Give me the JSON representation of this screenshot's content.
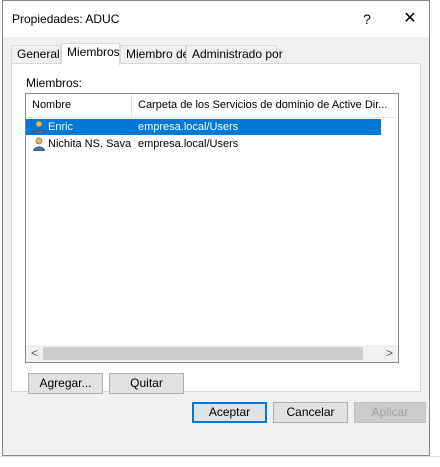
{
  "window": {
    "title": "Propiedades: ADUC",
    "help_label": "?",
    "close_label": "✕"
  },
  "tabs": [
    {
      "label": "General",
      "active": false
    },
    {
      "label": "Miembros",
      "active": true
    },
    {
      "label": "Miembro de",
      "active": false
    },
    {
      "label": "Administrado por",
      "active": false
    }
  ],
  "members": {
    "label": "Miembros:",
    "columns": [
      "Nombre",
      "Carpeta de los Servicios de dominio de Active Dir..."
    ],
    "rows": [
      {
        "name": "Enric",
        "path": "empresa.local/Users",
        "selected": true,
        "icon": "user-icon"
      },
      {
        "name": "Nichita NS. Sava",
        "path": "empresa.local/Users",
        "selected": false,
        "icon": "user-icon"
      }
    ],
    "scroll_left": "<",
    "scroll_right": ">"
  },
  "buttons": {
    "add": "Agregar...",
    "remove": "Quitar",
    "ok": "Aceptar",
    "cancel": "Cancelar",
    "apply": "Aplicar"
  },
  "colors": {
    "selection": "#0078d7",
    "dialog_bg": "#f0f0f0"
  }
}
